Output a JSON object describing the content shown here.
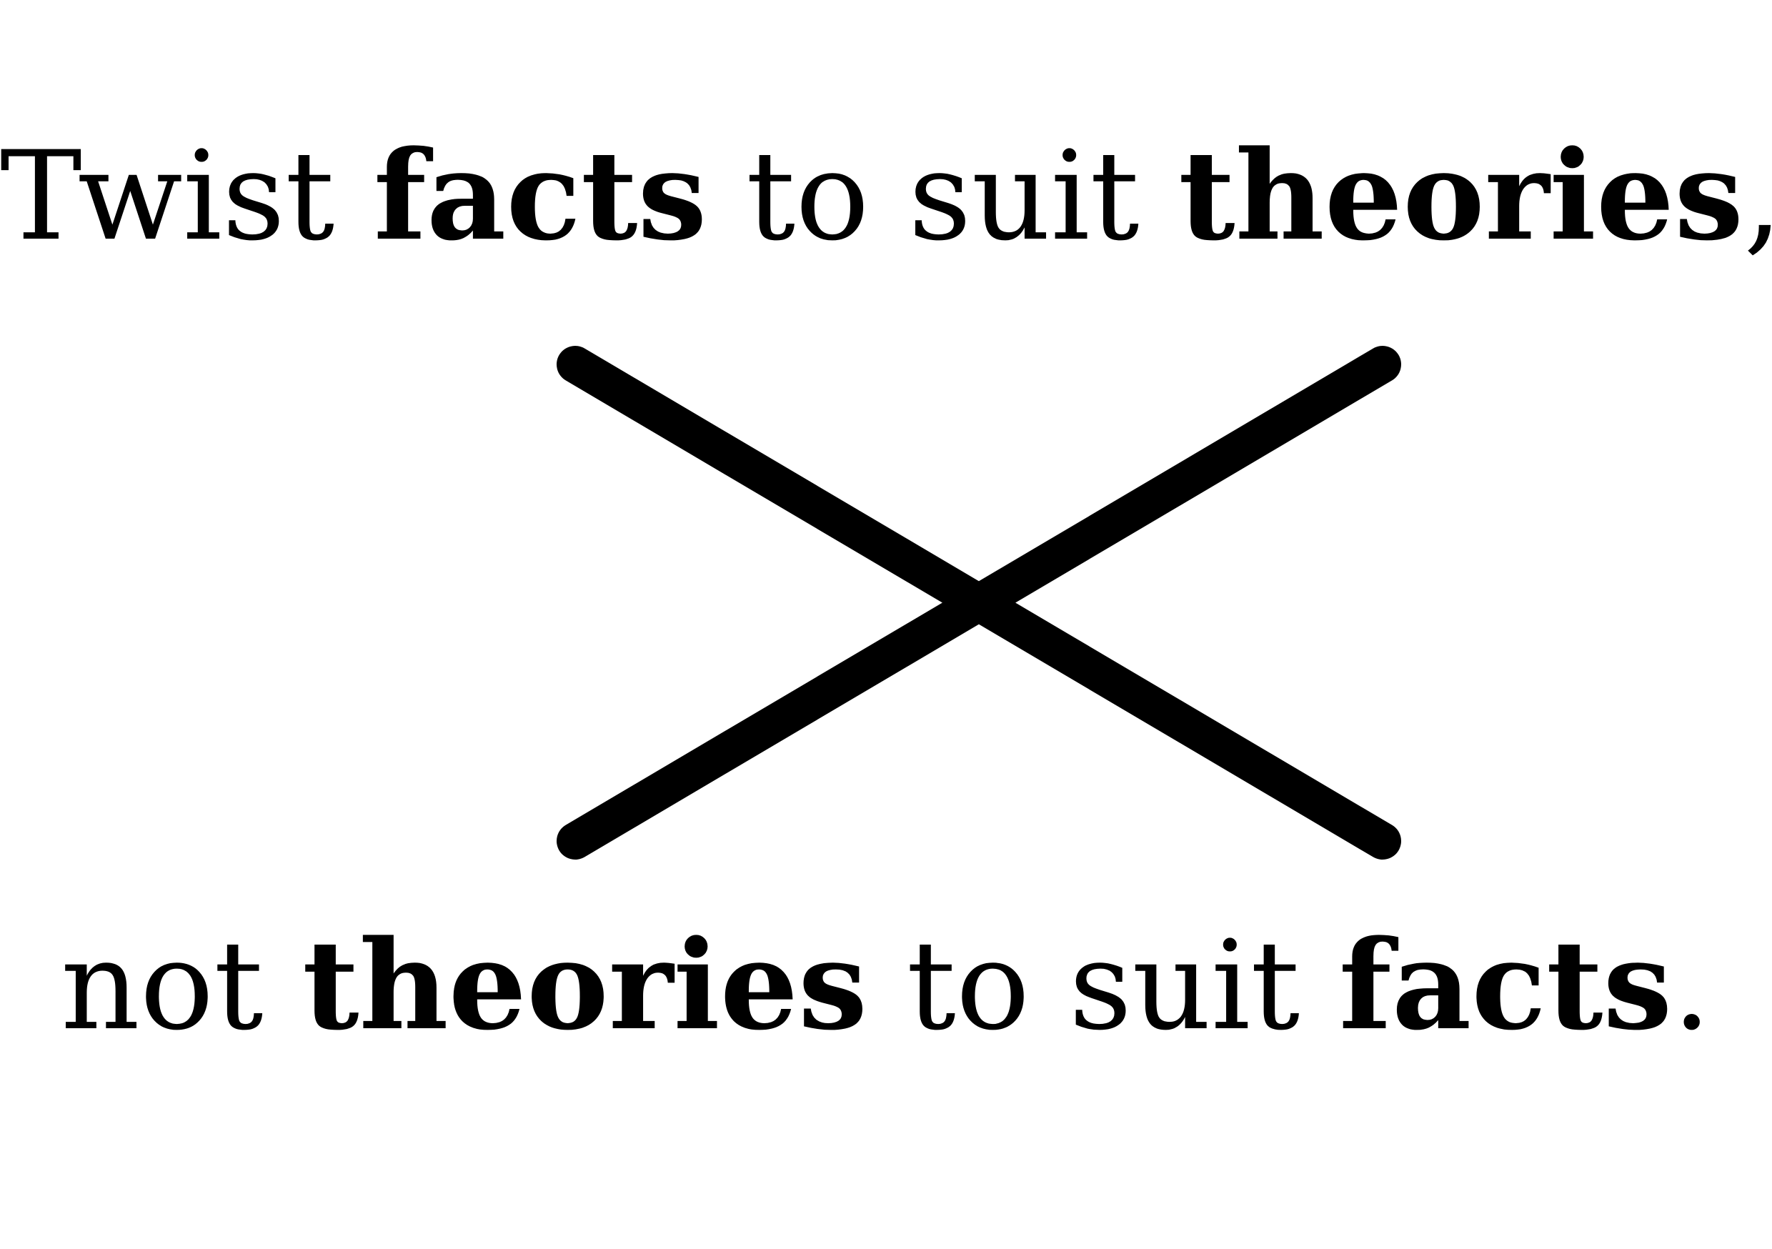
{
  "quote": {
    "line1": [
      {
        "text": "Twist ",
        "bold": false
      },
      {
        "text": "facts",
        "bold": true
      },
      {
        "text": " to suit ",
        "bold": false
      },
      {
        "text": "theories",
        "bold": true
      },
      {
        "text": ",",
        "bold": false
      }
    ],
    "line2": [
      {
        "text": "not ",
        "bold": false
      },
      {
        "text": "theories",
        "bold": true
      },
      {
        "text": " to suit ",
        "bold": false
      },
      {
        "text": "facts",
        "bold": true
      },
      {
        "text": ".",
        "bold": false
      }
    ]
  },
  "cross_icon": {
    "name": "cross-icon",
    "color": "#000000"
  }
}
